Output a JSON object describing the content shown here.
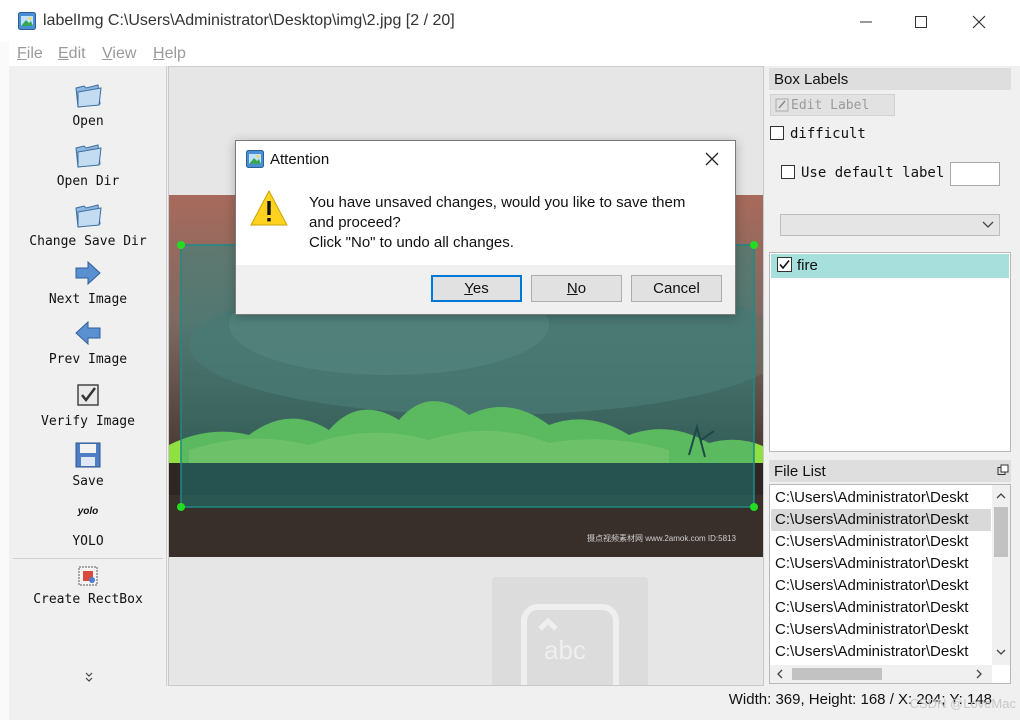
{
  "window": {
    "title": "labelImg C:\\Users\\Administrator\\Desktop\\img\\2.jpg [2 / 20]"
  },
  "menu": {
    "items": [
      {
        "label": "File",
        "mnemonic": "F",
        "rest": "ile"
      },
      {
        "label": "Edit",
        "mnemonic": "E",
        "rest": "dit"
      },
      {
        "label": "View",
        "mnemonic": "V",
        "rest": "iew"
      },
      {
        "label": "Help",
        "mnemonic": "H",
        "rest": "elp"
      }
    ]
  },
  "toolbar": {
    "items": [
      {
        "label": "Open",
        "icon": "folder-icon"
      },
      {
        "label": "Open Dir",
        "icon": "folder-icon"
      },
      {
        "label": "Change Save Dir",
        "icon": "folder-icon"
      },
      {
        "label": "Next Image",
        "icon": "arrow-right-icon"
      },
      {
        "label": "Prev Image",
        "icon": "arrow-left-icon"
      },
      {
        "label": "Verify Image",
        "icon": "checkbox-icon"
      },
      {
        "label": "Save",
        "icon": "floppy-icon"
      },
      {
        "label": "YOLO",
        "icon_text": "yolo"
      },
      {
        "label": "Create RectBox",
        "icon": "rectbox-icon"
      }
    ]
  },
  "canvas": {
    "photo_credit": "摄点视频素材网 www.2amok.com  ID:5813",
    "watermark_text": "abc",
    "box_color": "#1d8a86",
    "handle_color": "#22dd22"
  },
  "box_labels": {
    "title": "Box Labels",
    "edit_label": "Edit Label",
    "difficult_label": "difficult",
    "use_default_label": "Use default label",
    "default_label_value": "",
    "combo_value": "",
    "labels": [
      {
        "name": "fire",
        "checked": true
      }
    ]
  },
  "file_list": {
    "title": "File List",
    "files": [
      "C:\\Users\\Administrator\\Deskt",
      "C:\\Users\\Administrator\\Deskt",
      "C:\\Users\\Administrator\\Deskt",
      "C:\\Users\\Administrator\\Deskt",
      "C:\\Users\\Administrator\\Deskt",
      "C:\\Users\\Administrator\\Deskt",
      "C:\\Users\\Administrator\\Deskt",
      "C:\\Users\\Administrator\\Deskt"
    ],
    "selected_index": 1
  },
  "status": {
    "text": "Width: 369, Height: 168 / X: 204; Y: 148"
  },
  "overlay_watermark": "CSDN @LoveMac",
  "dialog": {
    "title": "Attention",
    "message_line1": "You have unsaved changes, would you like to save them",
    "message_line2": "and proceed?",
    "message_line3": "Click \"No\" to undo all changes.",
    "buttons": {
      "yes": {
        "mnemonic": "Y",
        "rest": "es"
      },
      "no": {
        "mnemonic": "N",
        "rest": "o"
      },
      "cancel": "Cancel"
    }
  }
}
